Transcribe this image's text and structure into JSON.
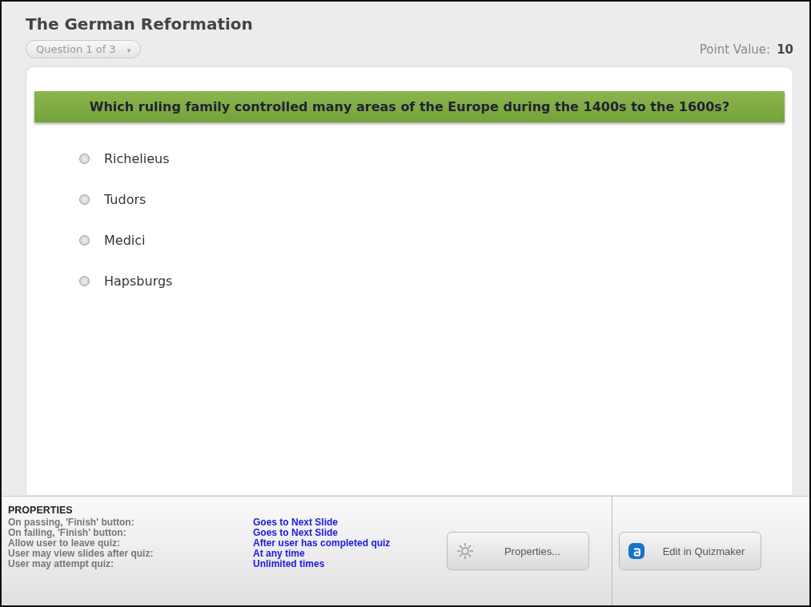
{
  "title": "The German Reformation",
  "question_selector": {
    "label": "Question 1 of 3",
    "caret": "▾"
  },
  "point_value": {
    "label": "Point Value:",
    "value": "10"
  },
  "question": "Which ruling family controlled many areas of the Europe during the 1400s to the 1600s?",
  "options": [
    {
      "label": "Richelieus",
      "selected": false
    },
    {
      "label": "Tudors",
      "selected": false
    },
    {
      "label": "Medici",
      "selected": false
    },
    {
      "label": "Hapsburgs",
      "selected": false
    }
  ],
  "properties": {
    "heading": "PROPERTIES",
    "rows": [
      {
        "label": "On passing, 'Finish' button:",
        "value": "Goes to Next Slide"
      },
      {
        "label": "On failing, 'Finish' button:",
        "value": "Goes to Next Slide"
      },
      {
        "label": "Allow user to leave quiz:",
        "value": "After user has completed quiz"
      },
      {
        "label": "User may view slides after quiz:",
        "value": "At any time"
      },
      {
        "label": "User may attempt quiz:",
        "value": "Unlimited times"
      }
    ]
  },
  "buttons": {
    "properties": "Properties...",
    "edit": "Edit in Quizmaker"
  }
}
